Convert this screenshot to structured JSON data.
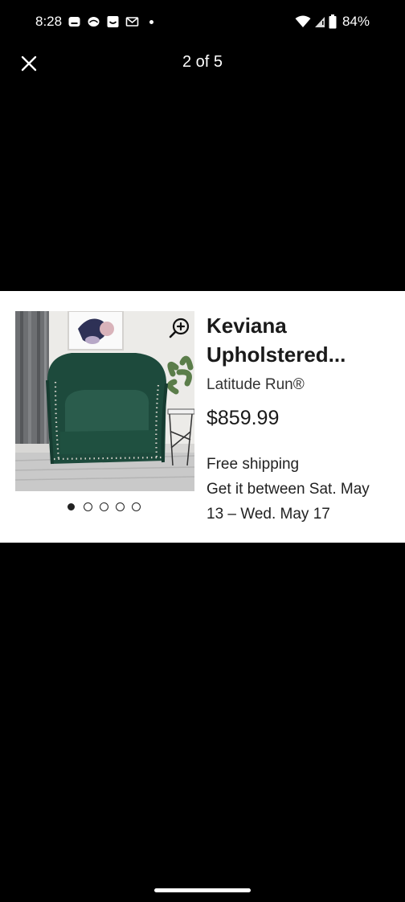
{
  "status_bar": {
    "time": "8:28",
    "battery": "84%",
    "notification_icons": [
      "message-icon",
      "chat-bubble-icon",
      "smile-app-icon",
      "gmail-icon"
    ]
  },
  "top_bar": {
    "counter": "2 of 5"
  },
  "product": {
    "title": "Keviana Upholstered...",
    "title_line1": "Keviana",
    "title_line2": "Upholstered...",
    "brand": "Latitude Run®",
    "price": "$859.99",
    "shipping_line1": "Free shipping",
    "shipping_line2": "Get it between Sat. May",
    "shipping_line3": "13 – Wed. May 17",
    "image_dots_total": 5,
    "image_dots_active": 1
  },
  "colors": {
    "background": "#000000",
    "card": "#ffffff",
    "chair": "#1f4d3f"
  }
}
